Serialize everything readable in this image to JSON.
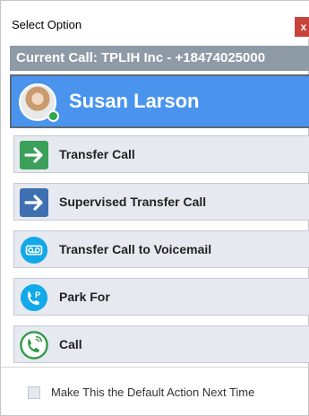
{
  "window": {
    "title": "Select Option",
    "close_label": "x"
  },
  "current_call": {
    "text": "Current Call: TPLIH Inc - +18474025000"
  },
  "contact": {
    "name": "Susan Larson",
    "status_color": "#2ea84a"
  },
  "options": [
    {
      "label": "Transfer Call",
      "icon": "arrow-right-green-icon"
    },
    {
      "label": "Supervised Transfer Call",
      "icon": "arrow-right-blue-icon"
    },
    {
      "label": "Transfer Call to Voicemail",
      "icon": "voicemail-icon"
    },
    {
      "label": "Park For",
      "icon": "park-phone-icon"
    },
    {
      "label": "Call",
      "icon": "phone-call-icon"
    }
  ],
  "default_action": {
    "label": "Make This the Default Action Next Time",
    "checked": false
  },
  "colors": {
    "accent_blue": "#4a94ee",
    "call_bar": "#8e9aa6",
    "green": "#3aa05a",
    "blue_dark": "#3e6fb0",
    "cyan": "#12a9e8"
  }
}
